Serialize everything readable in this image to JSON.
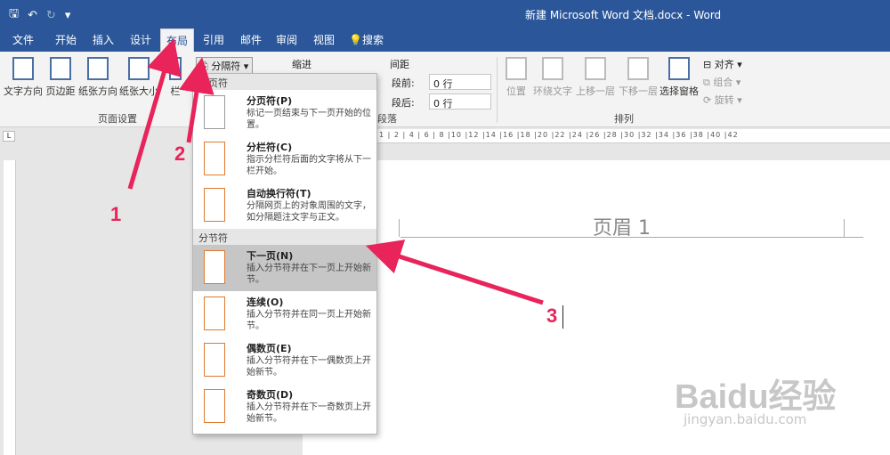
{
  "window": {
    "title": "新建 Microsoft Word 文档.docx  -  Word"
  },
  "qat": {
    "save": "🖫",
    "undo": "↶",
    "redo": "↻",
    "more": "▾"
  },
  "tabs": [
    "文件",
    "开始",
    "插入",
    "设计",
    "布局",
    "引用",
    "邮件",
    "审阅",
    "视图"
  ],
  "active_tab": "布局",
  "search": {
    "label": "搜索"
  },
  "ribbon": {
    "page_setup": {
      "text_direction": "文字方向",
      "margins": "页边距",
      "orientation": "纸张方向",
      "size": "纸张大小",
      "columns": "栏",
      "group_label": "页面设置"
    },
    "breaks_button": "分隔符",
    "indent_label": "缩进",
    "spacing_label": "间距",
    "spacing_before_label": "段前:",
    "spacing_before_value": "0 行",
    "spacing_after_label": "段后:",
    "spacing_after_value": "0 行",
    "paragraph_group_label": "段落",
    "arrange": {
      "position": "位置",
      "wrap": "环绕文字",
      "forward": "上移一层",
      "backward": "下移一层",
      "selection_pane": "选择窗格",
      "align": "对齐",
      "group": "组合",
      "rotate": "旋转",
      "group_label": "排列"
    }
  },
  "dropdown": {
    "section_page": "分页符",
    "section_section": "分节符",
    "items": [
      {
        "title": "分页符(P)",
        "desc": "标记一页结束与下一页开始的位置。"
      },
      {
        "title": "分栏符(C)",
        "desc": "指示分栏符后面的文字将从下一栏开始。"
      },
      {
        "title": "自动换行符(T)",
        "desc": "分隔网页上的对象周围的文字，如分隔题注文字与正文。"
      },
      {
        "title": "下一页(N)",
        "desc": "插入分节符并在下一页上开始新节。"
      },
      {
        "title": "连续(O)",
        "desc": "插入分节符并在同一页上开始新节。"
      },
      {
        "title": "偶数页(E)",
        "desc": "插入分节符并在下一偶数页上开始新节。"
      },
      {
        "title": "奇数页(D)",
        "desc": "插入分节符并在下一奇数页上开始新节。"
      }
    ]
  },
  "ruler_ticks": "1 | 2 | 4 | 6 | 8 |10 |12 |14 |16 |18 |20 |22 |24 |26 |28 |30 |32 |34 |36 |38 |40 |42",
  "document": {
    "header_text": "页眉 1"
  },
  "annotations": [
    "1",
    "2",
    "3"
  ],
  "watermark": {
    "main": "Baidu经验",
    "sub": "jingyan.baidu.com"
  }
}
